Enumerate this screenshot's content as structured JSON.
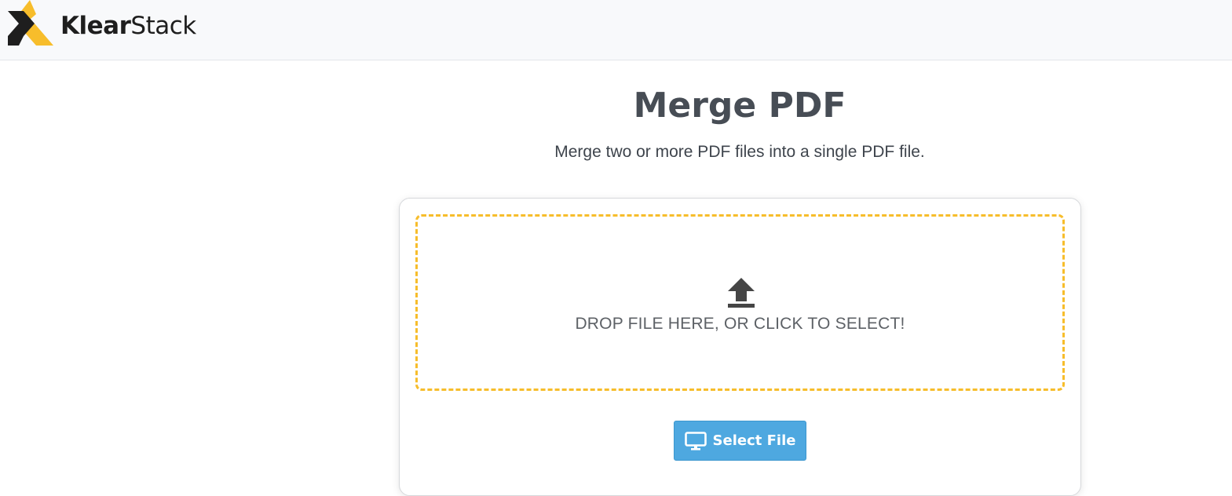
{
  "header": {
    "brand_bold": "Klear",
    "brand_light": "Stack",
    "logo_colors": {
      "yellow": "#f7bd2b",
      "dark": "#1e1e1e"
    }
  },
  "main": {
    "title": "Merge PDF",
    "subtitle": "Merge two or more PDF files into a single PDF file."
  },
  "uploader": {
    "drop_text": "DROP FILE HERE, OR CLICK TO SELECT!",
    "upload_icon": "upload-icon",
    "dropzone_border_color": "#f7bd2b",
    "select_button_label": "Select File",
    "select_button_icon": "monitor-icon",
    "select_button_color": "#4ea8e0"
  }
}
